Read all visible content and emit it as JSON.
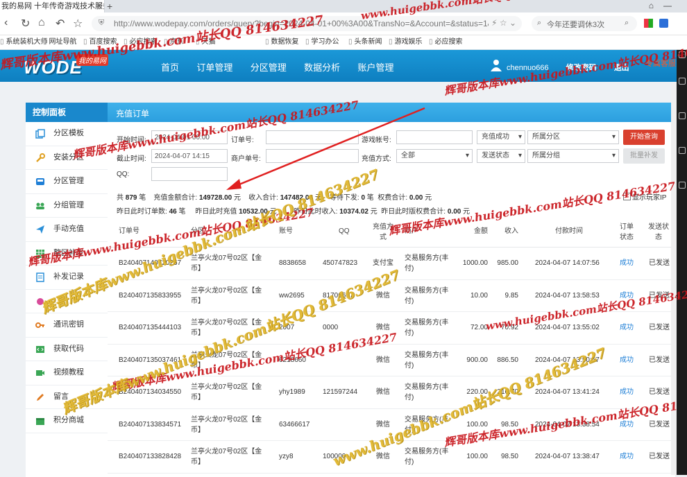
{
  "browser": {
    "tab_title": "我的易网 十年传奇游戏技术服务",
    "url": "http://www.wodepay.com/orders/query?begin=2024-04-01+00%3A00&TransNo=&Account=&status=1&",
    "search_placeholder": "今年还要调休3次",
    "bookmarks": [
      "系统装机大师",
      "网址导航",
      "百度搜索",
      "必应搜索",
      "京东",
      "天猫",
      "数据恢复",
      "学习办公",
      "头条新闻",
      "游戏娱乐",
      "必应搜索"
    ]
  },
  "app": {
    "logo_text": "WODE",
    "logo_badge": "我的易网",
    "nav": [
      "首页",
      "订单管理",
      "分区管理",
      "数据分析",
      "账户管理"
    ],
    "username": "chennuo666",
    "change_password": "修改密码",
    "logout": "退出",
    "red_link": "专属客服"
  },
  "sidebar": {
    "title": "控制面板",
    "items": [
      "分区模板",
      "安装分区",
      "分区管理",
      "分组管理",
      "手动充值",
      "整区补发",
      "补发记录",
      "",
      "通讯密钥",
      "获取代码",
      "视频教程",
      "留言",
      "积分商城"
    ]
  },
  "content_title": "充值订单",
  "filters": {
    "start_label": "开始时间:",
    "start_value": "2024-04-01 00:00",
    "end_label": "截止时间:",
    "end_value": "2024-04-07 14:15",
    "order_label": "订单号:",
    "trade_label": "商户单号:",
    "account_label": "游戏帐号:",
    "method_label": "充值方式:",
    "method_value": "全部",
    "status_value": "充值成功",
    "send_value": "发送状态",
    "zone_value": "所属分区",
    "group_value": "所属分组",
    "qq_label": "QQ:",
    "search_button": "开始查询",
    "batch_button": "批量补发",
    "show_ip": "显示玩家IP"
  },
  "summary": {
    "line1": {
      "count_prefix": "共",
      "count": "879",
      "count_unit": "笔",
      "amount_label": "充值金额合计:",
      "amount": "149728.00",
      "amount_unit": "元",
      "income_label": "收入合计:",
      "income": "147482.08",
      "income_unit": "元",
      "pending_label": "等待下发:",
      "pending": "0",
      "pending_unit": "笔",
      "fee_label": "权费合计:",
      "fee": "0.00",
      "fee_unit": "元"
    },
    "line2": {
      "orders_label": "昨日此时订单数:",
      "orders": "46",
      "orders_unit": "笔",
      "recharge_label": "昨日此时充值",
      "recharge": "10532.00",
      "recharge_unit": "元",
      "income_label": "昨日此时收入:",
      "income": "10374.02",
      "income_unit": "元",
      "fee_label": "昨日此时版权费合计:",
      "fee": "0.00",
      "fee_unit": "元"
    }
  },
  "table": {
    "headers": {
      "order_no": "订单号",
      "zone": "分区",
      "account": "账号",
      "qq": "QQ",
      "method": "充值方式",
      "merchant": "商户",
      "amount": "金额",
      "income": "收入",
      "pay_time": "付款时间",
      "order_status": "订单状态",
      "send_status": "发送状态"
    },
    "rows": [
      {
        "order_no": "B240407140720267",
        "zone": "兰亭火龙07号02区【金币】",
        "account": "8838658",
        "qq": "450747823",
        "method": "支付宝",
        "merchant": "交易服务方(丰付)",
        "amount": "1000.00",
        "income": "985.00",
        "time": "2024-04-07 14:07:56",
        "status": "成功",
        "send": "已发送"
      },
      {
        "order_no": "B240407135833955",
        "zone": "兰亭火龙07号02区【金币】",
        "account": "ww2695",
        "qq": "81706667",
        "method": "微信",
        "merchant": "交易服务方(丰付)",
        "amount": "10.00",
        "income": "9.85",
        "time": "2024-04-07 13:58:53",
        "status": "成功",
        "send": "已发送"
      },
      {
        "order_no": "B240407135444103",
        "zone": "兰亭火龙07号02区【金币】",
        "account": "2007",
        "qq": "0000",
        "method": "微信",
        "merchant": "交易服务方(丰付)",
        "amount": "72.00",
        "income": "70.92",
        "time": "2024-04-07 13:55:02",
        "status": "成功",
        "send": "已发送"
      },
      {
        "order_no": "B240407135037461",
        "zone": "兰亭火龙07号02区【金币】",
        "account": "6218660",
        "qq": "",
        "method": "微信",
        "merchant": "交易服务方(丰付)",
        "amount": "900.00",
        "income": "886.50",
        "time": "2024-04-07 13:50:57",
        "status": "成功",
        "send": "已发送"
      },
      {
        "order_no": "B240407134034550",
        "zone": "兰亭火龙07号02区【金币】",
        "account": "yhy1989",
        "qq": "121597244",
        "method": "微信",
        "merchant": "交易服务方(丰付)",
        "amount": "220.00",
        "income": "216.70",
        "time": "2024-04-07 13:41:24",
        "status": "成功",
        "send": "已发送"
      },
      {
        "order_no": "B240407133834571",
        "zone": "兰亭火龙07号02区【金币】",
        "account": "63466617",
        "qq": "",
        "method": "微信",
        "merchant": "交易服务方(丰付)",
        "amount": "100.00",
        "income": "98.50",
        "time": "2024-04-07 13:38:54",
        "status": "成功",
        "send": "已发送"
      },
      {
        "order_no": "B240407133828428",
        "zone": "兰亭火龙07号02区【金币】",
        "account": "yzy8",
        "qq": "100000",
        "method": "微信",
        "merchant": "交易服务方(丰付)",
        "amount": "100.00",
        "income": "98.50",
        "time": "2024-04-07 13:38:47",
        "status": "成功",
        "send": "已发送"
      }
    ]
  },
  "watermarks": [
    "辉哥版本库www.huigebbk.com站长QQ 814634227",
    "www.huigebbk.com站长QQ 814634227",
    "辉哥版本库www.huigebbk.com站长QQ 81"
  ],
  "colors": {
    "header_blue": "#1b98d8",
    "button_red": "#d9402e",
    "success_blue": "#1f7fd6",
    "watermark_red": "#c9161c",
    "watermark_yellow": "#e0b52a"
  }
}
